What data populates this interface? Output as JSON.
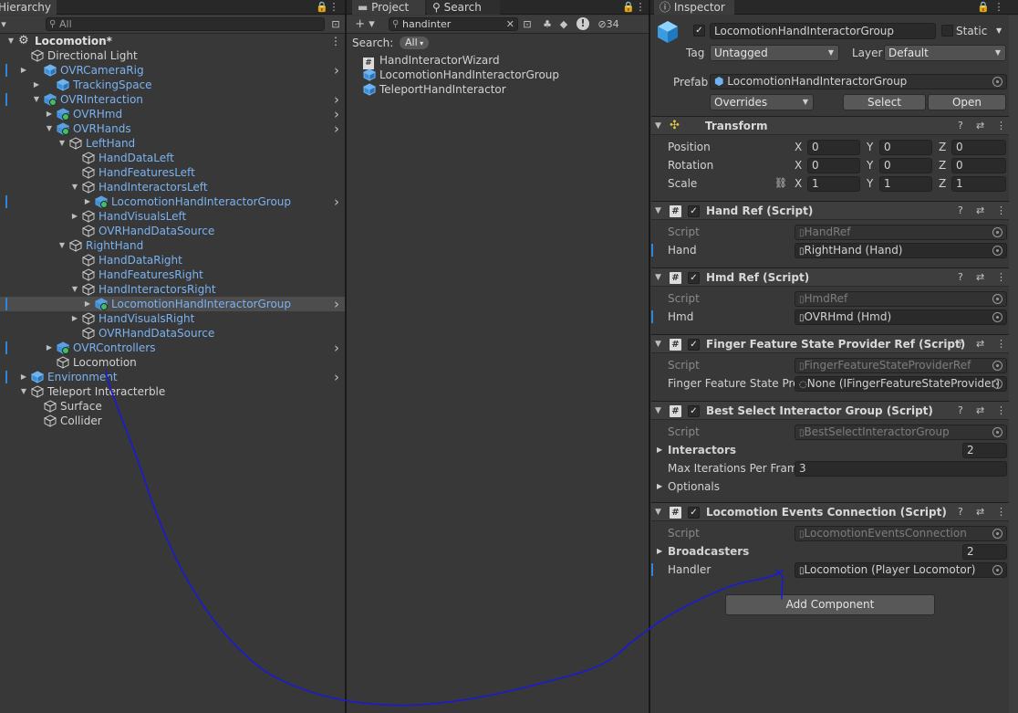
{
  "hierarchy": {
    "tab": "Hierarchy",
    "search_placeholder": "All",
    "scene": "Locomotion*",
    "items": [
      {
        "label": "Directional Light",
        "blue": false
      },
      {
        "label": "OVRCameraRig",
        "blue": true
      },
      {
        "label": "TrackingSpace",
        "blue": true
      },
      {
        "label": "OVRInteraction",
        "blue": true
      },
      {
        "label": "OVRHmd",
        "blue": true
      },
      {
        "label": "OVRHands",
        "blue": true
      },
      {
        "label": "LeftHand",
        "blue": true
      },
      {
        "label": "HandDataLeft",
        "blue": true
      },
      {
        "label": "HandFeaturesLeft",
        "blue": true
      },
      {
        "label": "HandInteractorsLeft",
        "blue": true
      },
      {
        "label": "LocomotionHandInteractorGroup",
        "blue": true
      },
      {
        "label": "HandVisualsLeft",
        "blue": true
      },
      {
        "label": "OVRHandDataSource",
        "blue": true
      },
      {
        "label": "RightHand",
        "blue": true
      },
      {
        "label": "HandDataRight",
        "blue": true
      },
      {
        "label": "HandFeaturesRight",
        "blue": true
      },
      {
        "label": "HandInteractorsRight",
        "blue": true
      },
      {
        "label": "LocomotionHandInteractorGroup",
        "blue": true
      },
      {
        "label": "HandVisualsRight",
        "blue": true
      },
      {
        "label": "OVRHandDataSource",
        "blue": true
      },
      {
        "label": "OVRControllers",
        "blue": true
      },
      {
        "label": "Locomotion",
        "blue": false
      },
      {
        "label": "Environment",
        "blue": true
      },
      {
        "label": "Teleport Interacterble",
        "blue": false
      },
      {
        "label": "Surface",
        "blue": false
      },
      {
        "label": "Collider",
        "blue": false
      }
    ]
  },
  "project": {
    "tab_project": "Project",
    "tab_search": "Search",
    "search_value": "handinter",
    "hidden_count": "34",
    "search_label": "Search:",
    "search_scope": "All",
    "results": [
      "HandInteractorWizard",
      "LocomotionHandInteractorGroup",
      "TeleportHandInteractor"
    ]
  },
  "inspector": {
    "tab": "Inspector",
    "object_name": "LocomotionHandInteractorGroup",
    "static_label": "Static",
    "tag_label": "Tag",
    "tag_value": "Untagged",
    "layer_label": "Layer",
    "layer_value": "Default",
    "prefab_label": "Prefab",
    "prefab_value": "LocomotionHandInteractorGroup",
    "overrides": "Overrides",
    "select": "Select",
    "open": "Open",
    "transform": {
      "title": "Transform",
      "position_label": "Position",
      "rotation_label": "Rotation",
      "scale_label": "Scale",
      "position": [
        "0",
        "0",
        "0"
      ],
      "rotation": [
        "0",
        "0",
        "0"
      ],
      "scale": [
        "1",
        "1",
        "1"
      ],
      "axes": [
        "X",
        "Y",
        "Z"
      ]
    },
    "hand_ref": {
      "title": "Hand Ref (Script)",
      "script_label": "Script",
      "script": "HandRef",
      "field_label": "Hand",
      "field": "RightHand (Hand)"
    },
    "hmd_ref": {
      "title": "Hmd Ref (Script)",
      "script_label": "Script",
      "script": "HmdRef",
      "field_label": "Hmd",
      "field": "OVRHmd (Hmd)"
    },
    "finger_ref": {
      "title": "Finger Feature State Provider Ref (Script)",
      "script_label": "Script",
      "script": "FingerFeatureStateProviderRef",
      "field_label": "Finger Feature State Pro",
      "field": "None (IFingerFeatureStateProvider)"
    },
    "best_select": {
      "title": "Best Select Interactor Group (Script)",
      "script_label": "Script",
      "script": "BestSelectInteractorGroup",
      "interactors_label": "Interactors",
      "interactors": "2",
      "max_label": "Max Iterations Per Frame",
      "max": "3",
      "optionals_label": "Optionals"
    },
    "loco_events": {
      "title": "Locomotion Events Connection (Script)",
      "script_label": "Script",
      "script": "LocomotionEventsConnection",
      "broadcasters_label": "Broadcasters",
      "broadcasters": "2",
      "handler_label": "Handler",
      "handler": "Locomotion (Player Locomotor)"
    },
    "add_component": "Add Component"
  },
  "annotation_color": "#1a1ad6",
  "accent": "#7bb2f0"
}
